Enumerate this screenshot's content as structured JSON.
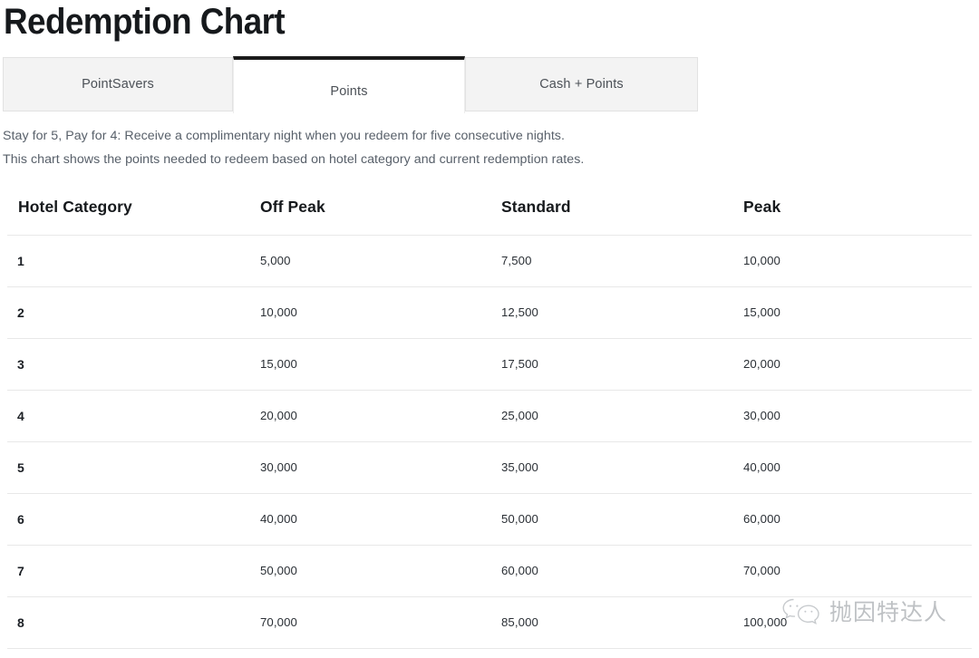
{
  "page": {
    "title": "Redemption Chart"
  },
  "tabs": {
    "items": [
      {
        "id": "pointsavers",
        "label": "PointSavers",
        "active": false
      },
      {
        "id": "points",
        "label": "Points",
        "active": true
      },
      {
        "id": "cash-points",
        "label": "Cash + Points",
        "active": false
      }
    ],
    "active_indicator_color": "#1b1b1b",
    "inactive_background": "#f3f3f3"
  },
  "description": {
    "line1": "Stay for 5, Pay for 4: Receive a complimentary night when you redeem for five consecutive nights.",
    "line2": "This chart shows the points needed to redeem based on hotel category and current redemption rates."
  },
  "table": {
    "columns": [
      "Hotel Category",
      "Off Peak",
      "Standard",
      "Peak"
    ],
    "rows": [
      {
        "category": "1",
        "off_peak": "5,000",
        "standard": "7,500",
        "peak": "10,000"
      },
      {
        "category": "2",
        "off_peak": "10,000",
        "standard": "12,500",
        "peak": "15,000"
      },
      {
        "category": "3",
        "off_peak": "15,000",
        "standard": "17,500",
        "peak": "20,000"
      },
      {
        "category": "4",
        "off_peak": "20,000",
        "standard": "25,000",
        "peak": "30,000"
      },
      {
        "category": "5",
        "off_peak": "30,000",
        "standard": "35,000",
        "peak": "40,000"
      },
      {
        "category": "6",
        "off_peak": "40,000",
        "standard": "50,000",
        "peak": "60,000"
      },
      {
        "category": "7",
        "off_peak": "50,000",
        "standard": "60,000",
        "peak": "70,000"
      },
      {
        "category": "8",
        "off_peak": "70,000",
        "standard": "85,000",
        "peak": "100,000"
      }
    ]
  },
  "watermark": {
    "icon": "wechat-logo-icon",
    "text": "抛因特达人",
    "color": "#8a8f95"
  },
  "chart_data": {
    "type": "table",
    "title": "Redemption Chart",
    "subtitle": "This chart shows the points needed to redeem based on hotel category and current redemption rates.",
    "categories": [
      "1",
      "2",
      "3",
      "4",
      "5",
      "6",
      "7",
      "8"
    ],
    "xlabel": "Hotel Category",
    "ylabel": "Points",
    "series": [
      {
        "name": "Off Peak",
        "values": [
          5000,
          10000,
          15000,
          20000,
          30000,
          40000,
          50000,
          70000
        ]
      },
      {
        "name": "Standard",
        "values": [
          7500,
          12500,
          17500,
          25000,
          35000,
          50000,
          60000,
          85000
        ]
      },
      {
        "name": "Peak",
        "values": [
          10000,
          15000,
          20000,
          30000,
          40000,
          60000,
          70000,
          100000
        ]
      }
    ]
  }
}
